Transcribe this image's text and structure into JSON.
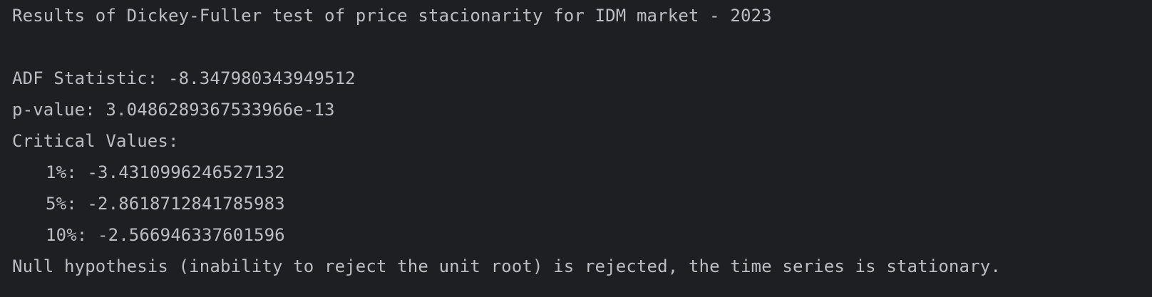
{
  "console": {
    "title_line": "Results of Dickey-Fuller test of price stacionarity for IDM market - 2023",
    "adf_statistic": "ADF Statistic: -8.347980343949512",
    "p_value": "p-value: 3.0486289367533966e-13",
    "critical_values_header": "Critical Values:",
    "critical_values": [
      "1%: -3.4310996246527132",
      "5%: -2.8618712841785983",
      "10%: -2.566946337601596"
    ],
    "conclusion": "Null hypothesis (inability to reject the unit root) is rejected, the time series is stationary."
  }
}
